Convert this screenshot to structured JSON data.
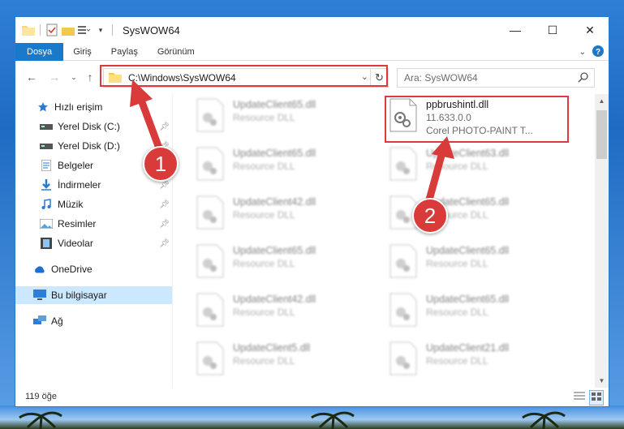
{
  "window": {
    "title": "SysWOW64",
    "controls": {
      "minimize": "—",
      "maximize": "☐",
      "close": "✕"
    }
  },
  "ribbon": {
    "tabs": [
      {
        "label": "Dosya"
      },
      {
        "label": "Giriş"
      },
      {
        "label": "Paylaş"
      },
      {
        "label": "Görünüm"
      }
    ]
  },
  "address": {
    "path": "C:\\Windows\\SysWOW64"
  },
  "search": {
    "placeholder": "Ara: SysWOW64"
  },
  "nav": {
    "items": [
      {
        "label": "Hızlı erişim",
        "icon": "star-icon"
      },
      {
        "label": "Yerel Disk (C:)",
        "icon": "drive-icon"
      },
      {
        "label": "Yerel Disk (D:)",
        "icon": "drive-icon"
      },
      {
        "label": "Belgeler",
        "icon": "documents-icon"
      },
      {
        "label": "İndirmeler",
        "icon": "download-icon"
      },
      {
        "label": "Müzik",
        "icon": "music-icon"
      },
      {
        "label": "Resimler",
        "icon": "pictures-icon"
      },
      {
        "label": "Videolar",
        "icon": "videos-icon"
      },
      {
        "label": "OneDrive",
        "icon": "cloud-icon"
      },
      {
        "label": "Bu bilgisayar",
        "icon": "computer-icon"
      },
      {
        "label": "Ağ",
        "icon": "network-icon"
      }
    ]
  },
  "files": {
    "left": [
      {
        "name": "UpdateClient65.dll",
        "type": "Resource DLL"
      },
      {
        "name": "UpdateClient65.dll",
        "type": "Resource DLL"
      },
      {
        "name": "UpdateClient42.dll",
        "type": "Resource DLL"
      },
      {
        "name": "UpdateClient65.dll",
        "type": "Resource DLL"
      },
      {
        "name": "UpdateClient42.dll",
        "type": "Resource DLL"
      },
      {
        "name": "UpdateClient5.dll",
        "type": "Resource DLL"
      }
    ],
    "right": [
      {
        "name": "ppbrushintl.dll",
        "version": "11.633.0.0",
        "desc": "Corel PHOTO-PAINT T..."
      },
      {
        "name": "UpdateClient63.dll",
        "type": "Resource DLL"
      },
      {
        "name": "UpdateClient65.dll",
        "type": "Resource DLL"
      },
      {
        "name": "UpdateClient65.dll",
        "type": "Resource DLL"
      },
      {
        "name": "UpdateClient65.dll",
        "type": "Resource DLL"
      },
      {
        "name": "UpdateClient21.dll",
        "type": "Resource DLL"
      }
    ]
  },
  "status": {
    "count": "119 öğe"
  },
  "annotations": {
    "badge1": "1",
    "badge2": "2",
    "color": "#d93a3a"
  }
}
